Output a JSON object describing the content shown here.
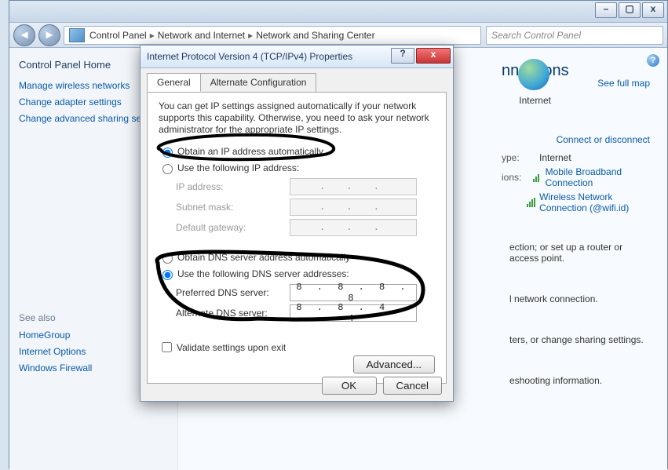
{
  "window": {
    "breadcrumb": {
      "p1": "Control Panel",
      "p2": "Network and Internet",
      "p3": "Network and Sharing Center"
    },
    "search_placeholder": "Search Control Panel"
  },
  "sidebar": {
    "heading": "Control Panel Home",
    "links": [
      "Manage wireless networks",
      "Change adapter settings",
      "Change advanced sharing settings"
    ],
    "see_also_heading": "See also",
    "see_also": [
      "HomeGroup",
      "Internet Options",
      "Windows Firewall"
    ]
  },
  "main": {
    "title_fragment": "nnections",
    "map_link": "See full map",
    "globe_caption": "Internet",
    "connect_link": "Connect or disconnect",
    "rows": {
      "access_type_label": "ype:",
      "access_type_value": "Internet",
      "conn_label": "ions:",
      "conn1": "Mobile Broadband Connection",
      "conn2": "Wireless Network Connection (@wifi.id)"
    },
    "frag1": "ection; or set up a router or access point.",
    "frag2": "l network connection.",
    "frag3": "ters, or change sharing settings.",
    "frag4": "eshooting information."
  },
  "dialog": {
    "title": "Internet Protocol Version 4 (TCP/IPv4) Properties",
    "tabs": {
      "general": "General",
      "alt": "Alternate Configuration"
    },
    "desc": "You can get IP settings assigned automatically if your network supports this capability. Otherwise, you need to ask your network administrator for the appropriate IP settings.",
    "opt_ip_auto": "Obtain an IP address automatically",
    "opt_ip_manual": "Use the following IP address:",
    "ip_labels": {
      "ip": "IP address:",
      "mask": "Subnet mask:",
      "gw": "Default gateway:"
    },
    "opt_dns_auto": "Obtain DNS server address automatically",
    "opt_dns_manual": "Use the following DNS server addresses:",
    "dns_labels": {
      "pref": "Preferred DNS server:",
      "alt": "Alternate DNS server:"
    },
    "dns_values": {
      "pref": "8 . 8 . 8 . 8",
      "alt": "8 . 8 . 4 . 4"
    },
    "validate": "Validate settings upon exit",
    "advanced": "Advanced...",
    "ok": "OK",
    "cancel": "Cancel"
  }
}
